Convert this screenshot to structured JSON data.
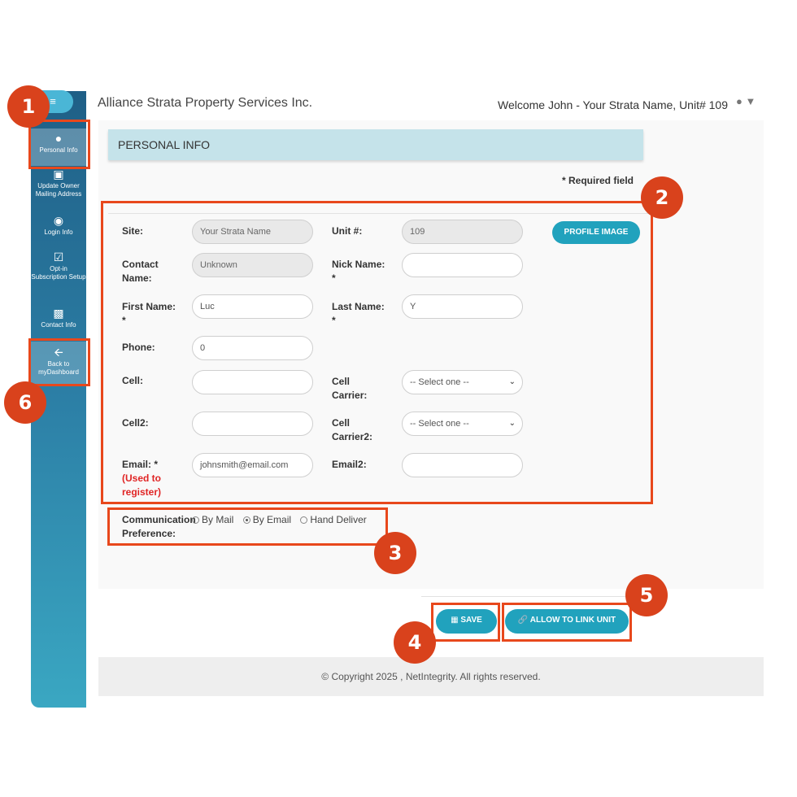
{
  "header": {
    "app_title": "Alliance Strata Property Services Inc.",
    "welcome": "Welcome John - Your Strata Name, Unit# 109"
  },
  "sidebar": {
    "items": [
      {
        "label": "Personal Info",
        "icon": "person-icon"
      },
      {
        "label": "Update Owner Mailing Address",
        "icon": "id-badge-icon"
      },
      {
        "label": "Login Info",
        "icon": "user-circle-icon"
      },
      {
        "label": "Opt-in Subscription Setup",
        "icon": "checkbox-icon"
      },
      {
        "label": "Contact Info",
        "icon": "contact-card-icon"
      },
      {
        "label": "Back to myDashboard",
        "icon": "arrow-left-icon"
      }
    ]
  },
  "section": {
    "title": "PERSONAL INFO",
    "required_note": "* Required field"
  },
  "form": {
    "site_label": "Site:",
    "site_value": "Your Strata Name",
    "unit_label": "Unit #:",
    "unit_value": "109",
    "profile_image_button": "PROFILE IMAGE",
    "contact_label": "Contact Name:",
    "contact_value": "Unknown",
    "nick_label": "Nick Name:",
    "nick_req": "*",
    "first_label": "First Name:",
    "first_req": "*",
    "first_value": "Luc",
    "last_label": "Last Name:",
    "last_req": "*",
    "last_value": "Y",
    "phone_label": "Phone:",
    "phone_value": "0",
    "cell_label": "Cell:",
    "cell_carrier_label": "Cell Carrier:",
    "cell_carrier_value": "-- Select one --",
    "cell2_label": "Cell2:",
    "cell_carrier2_label": "Cell Carrier2:",
    "cell_carrier2_value": "-- Select one --",
    "email_label": "Email: *",
    "email_note": "(Used to register)",
    "email_value": "johnsmith@email.com",
    "email2_label": "Email2:",
    "comm_label": "Communication Preference:",
    "comm_options": [
      "By Mail",
      "By Email",
      "Hand Deliver"
    ],
    "comm_selected": "By Email"
  },
  "actions": {
    "save": "SAVE",
    "allow_link": "ALLOW TO LINK UNIT"
  },
  "footer": {
    "copyright": "© Copyright 2025 , NetIntegrity. All rights reserved."
  },
  "callouts": [
    "1",
    "2",
    "3",
    "4",
    "5",
    "6"
  ],
  "colors": {
    "accent": "#21a2bd",
    "header_band": "#c5e3ea",
    "callout": "#d9421c",
    "highlight": "#e8481c"
  }
}
